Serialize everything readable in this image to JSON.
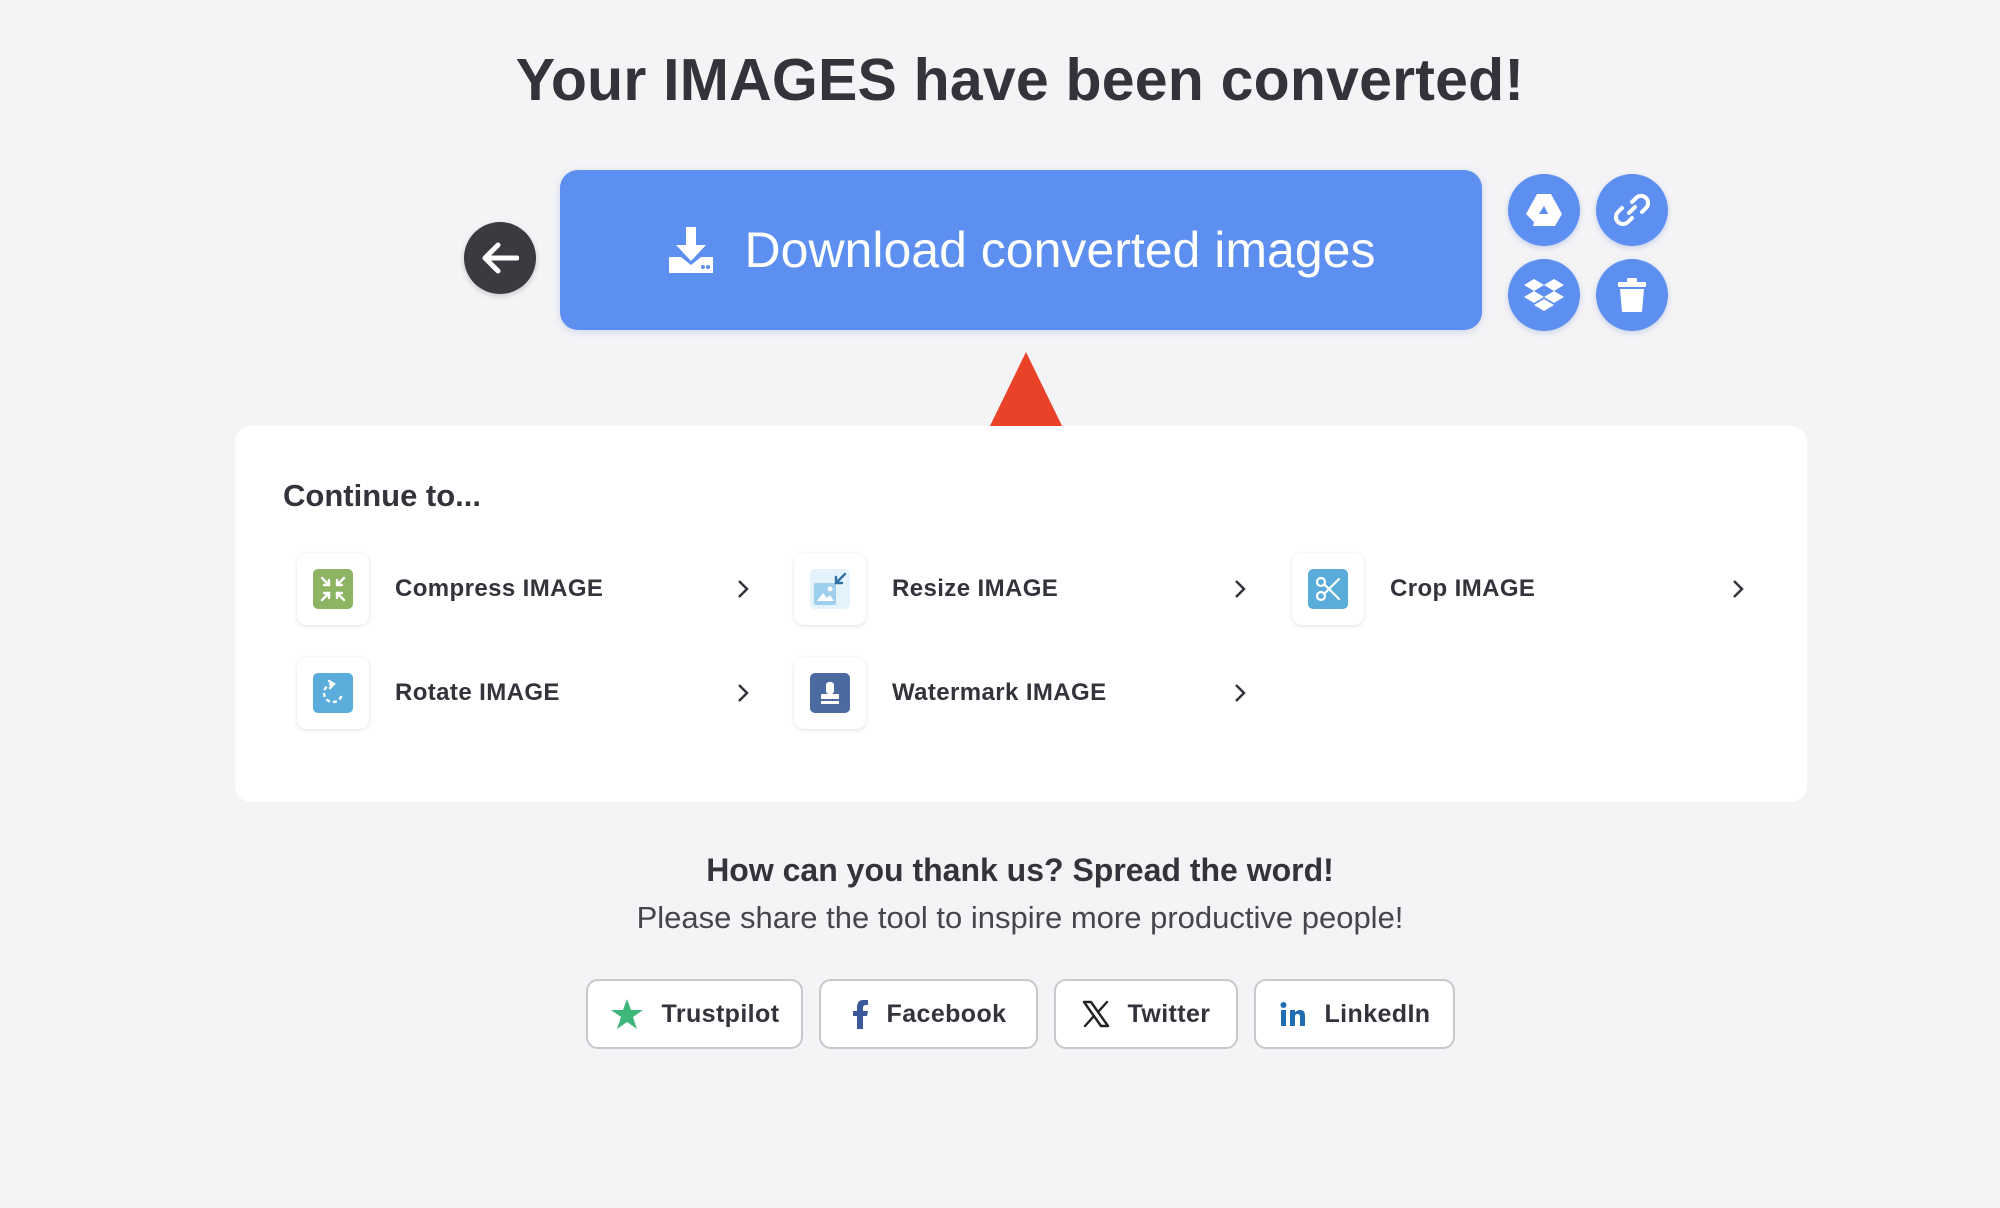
{
  "heading": "Your IMAGES have been converted!",
  "download": {
    "label": "Download converted images"
  },
  "continue": {
    "title": "Continue to...",
    "tools": [
      {
        "label": "Compress IMAGE",
        "icon": "compress-icon",
        "color": "#8db462"
      },
      {
        "label": "Resize IMAGE",
        "icon": "resize-icon",
        "color": "#9fcfee"
      },
      {
        "label": "Crop IMAGE",
        "icon": "crop-icon",
        "color": "#5aacdb"
      },
      {
        "label": "Rotate IMAGE",
        "icon": "rotate-icon",
        "color": "#5aacdb"
      },
      {
        "label": "Watermark IMAGE",
        "icon": "watermark-icon",
        "color": "#4a6aa0"
      }
    ]
  },
  "thanks": {
    "title": "How can you thank us? Spread the word!",
    "subtitle": "Please share the tool to inspire more productive people!"
  },
  "share": [
    {
      "label": "Trustpilot",
      "icon": "trustpilot-star-icon"
    },
    {
      "label": "Facebook",
      "icon": "facebook-icon"
    },
    {
      "label": "Twitter",
      "icon": "x-twitter-icon"
    },
    {
      "label": "LinkedIn",
      "icon": "linkedin-icon"
    }
  ],
  "colors": {
    "primary": "#5d8ff1",
    "dark": "#3a3a40",
    "annotation_arrow": "#ea4129",
    "background": "#f4f4f6"
  }
}
